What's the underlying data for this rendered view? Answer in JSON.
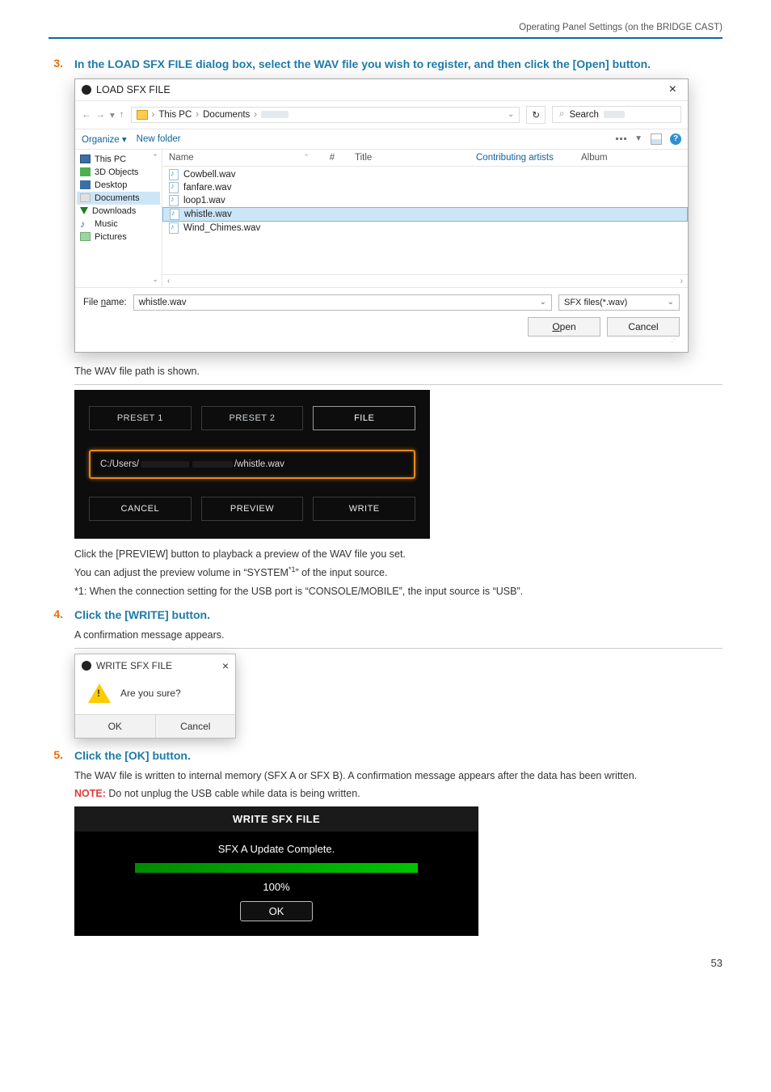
{
  "header": {
    "running": "Operating Panel Settings (on the BRIDGE CAST)"
  },
  "step3": {
    "num": "3.",
    "head": "In the LOAD SFX FILE dialog box, select the WAV file you wish to register, and then click the [Open] button."
  },
  "open_dialog": {
    "title": "LOAD SFX FILE",
    "close": "×",
    "breadcrumb": {
      "seg1": "This PC",
      "seg2": "Documents"
    },
    "refresh": "↻",
    "search_placeholder": "Search",
    "toolbar": {
      "organize": "Organize ▾",
      "new_folder": "New folder",
      "help": "?"
    },
    "tree": [
      {
        "key": "this-pc",
        "label": "This PC"
      },
      {
        "key": "3d",
        "label": "3D Objects"
      },
      {
        "key": "desktop",
        "label": "Desktop"
      },
      {
        "key": "documents",
        "label": "Documents"
      },
      {
        "key": "downloads",
        "label": "Downloads"
      },
      {
        "key": "music",
        "label": "Music"
      },
      {
        "key": "pictures",
        "label": "Pictures"
      }
    ],
    "columns": {
      "name": "Name",
      "num": "#",
      "title": "Title",
      "contrib": "Contributing artists",
      "album": "Album"
    },
    "files": [
      "Cowbell.wav",
      "fanfare.wav",
      "loop1.wav",
      "whistle.wav",
      "Wind_Chimes.wav"
    ],
    "selected_index": 3,
    "filename_label_pre": "File ",
    "filename_label_u": "n",
    "filename_label_post": "ame:",
    "filename_value": "whistle.wav",
    "filetype": "SFX files(*.wav)",
    "open_u": "O",
    "open_rest": "pen",
    "cancel": "Cancel"
  },
  "after_open": {
    "line": "The WAV file path is shown."
  },
  "app_panel": {
    "tabs": {
      "preset1": "PRESET 1",
      "preset2": "PRESET 2",
      "file": "FILE"
    },
    "path_prefix": "C:/Users/",
    "path_suffix": "/whistle.wav",
    "buttons": {
      "cancel": "CANCEL",
      "preview": "PREVIEW",
      "write": "WRITE"
    }
  },
  "after_panel": {
    "l1": "Click the [PREVIEW] button to playback a preview of the WAV file you set.",
    "l2a": "You can adjust the preview volume in “SYSTEM",
    "l2sup": "*1",
    "l2b": "” of the input source.",
    "l3": "*1: When the connection setting for the USB port is “CONSOLE/MOBILE”, the input source is “USB”."
  },
  "step4": {
    "num": "4.",
    "head": "Click the [WRITE] button."
  },
  "confirm_intro": "A confirmation message appears.",
  "msgbox": {
    "title": "WRITE SFX FILE",
    "close": "×",
    "text": "Are you sure?",
    "ok": "OK",
    "cancel": "Cancel"
  },
  "step5": {
    "num": "5.",
    "head": "Click the [OK] button."
  },
  "after5": {
    "l1": "The WAV file is written to internal memory (SFX A or SFX B). A confirmation message appears after the data has been written.",
    "note_label": "NOTE:",
    "note": " Do not unplug the USB cable while data is being written."
  },
  "done": {
    "title": "WRITE SFX FILE",
    "msg": "SFX A Update Complete.",
    "pct": "100%",
    "ok": "OK"
  },
  "page_number": "53"
}
